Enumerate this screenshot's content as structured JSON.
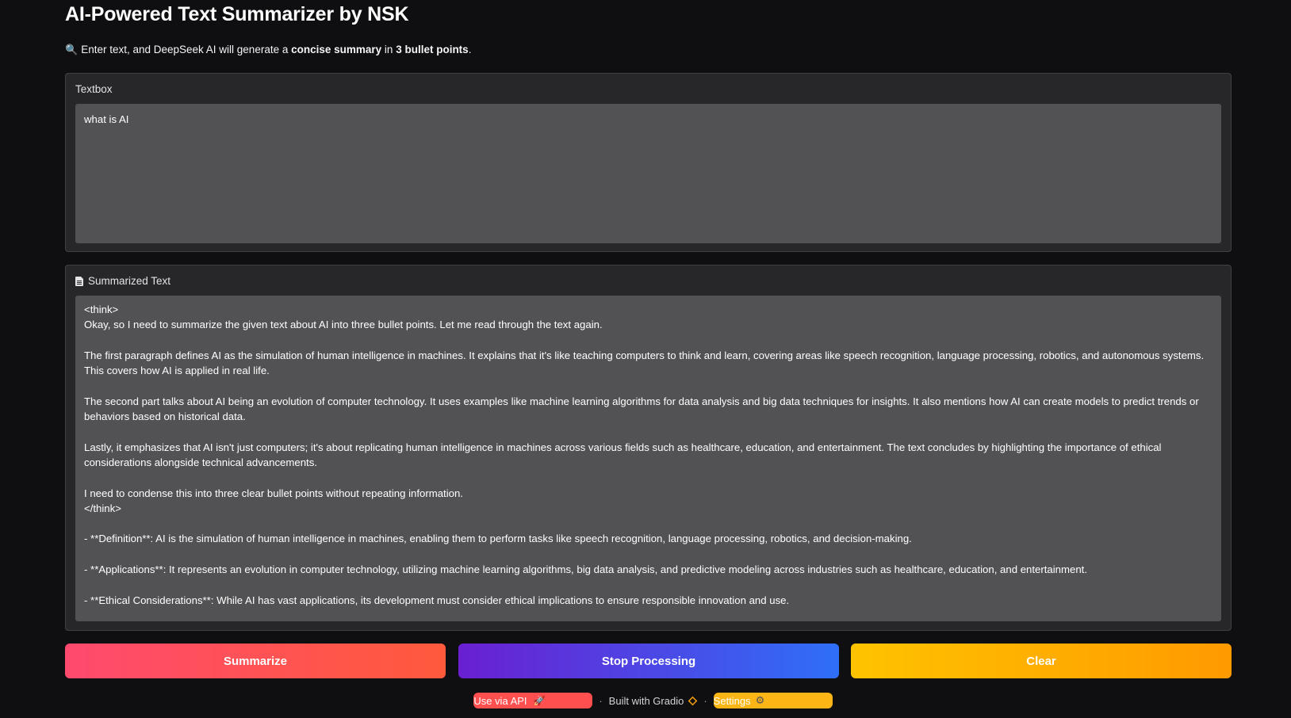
{
  "header": {
    "title": "AI-Powered Text Summarizer by NSK",
    "intro_icon": "magnifying-glass-icon",
    "intro_prefix": "Enter text, and DeepSeek AI will generate a ",
    "intro_bold1": "concise summary",
    "intro_mid": " in ",
    "intro_bold2": "3 bullet points",
    "intro_suffix": "."
  },
  "input_panel": {
    "label": "Textbox",
    "value": "what is AI"
  },
  "output_panel": {
    "label": "Summarized Text",
    "icon": "document-icon",
    "value": "<think>\nOkay, so I need to summarize the given text about AI into three bullet points. Let me read through the text again.\n\nThe first paragraph defines AI as the simulation of human intelligence in machines. It explains that it's like teaching computers to think and learn, covering areas like speech recognition, language processing, robotics, and autonomous systems. This covers how AI is applied in real life.\n\nThe second part talks about AI being an evolution of computer technology. It uses examples like machine learning algorithms for data analysis and big data techniques for insights. It also mentions how AI can create models to predict trends or behaviors based on historical data.\n\nLastly, it emphasizes that AI isn't just computers; it's about replicating human intelligence in machines across various fields such as healthcare, education, and entertainment. The text concludes by highlighting the importance of ethical considerations alongside technical advancements.\n\nI need to condense this into three clear bullet points without repeating information.\n</think>\n\n- **Definition**: AI is the simulation of human intelligence in machines, enabling them to perform tasks like speech recognition, language processing, robotics, and decision-making.\n\n- **Applications**: It represents an evolution in computer technology, utilizing machine learning algorithms, big data analysis, and predictive modeling across industries such as healthcare, education, and entertainment.\n\n- **Ethical Considerations**: While AI has vast applications, its development must consider ethical implications to ensure responsible innovation and use."
  },
  "buttons": {
    "summarize": "Summarize",
    "stop": "Stop Processing",
    "clear": "Clear"
  },
  "footer": {
    "api_label": "Use via API",
    "api_icon": "rocket-icon",
    "separator": "·",
    "built_with": "Built with Gradio",
    "gradio_icon": "gradio-logo-icon",
    "settings_label": "Settings",
    "settings_icon": "gear-icon"
  },
  "colors": {
    "background": "#0f0f11",
    "panel": "#27272a",
    "textbox": "#525255",
    "summarize_gradient": [
      "#ff4a6e",
      "#ff5a3c"
    ],
    "stop_gradient": [
      "#6a1fd1",
      "#2f6ff8"
    ],
    "clear_gradient": [
      "#ffc300",
      "#ff9a00"
    ]
  }
}
